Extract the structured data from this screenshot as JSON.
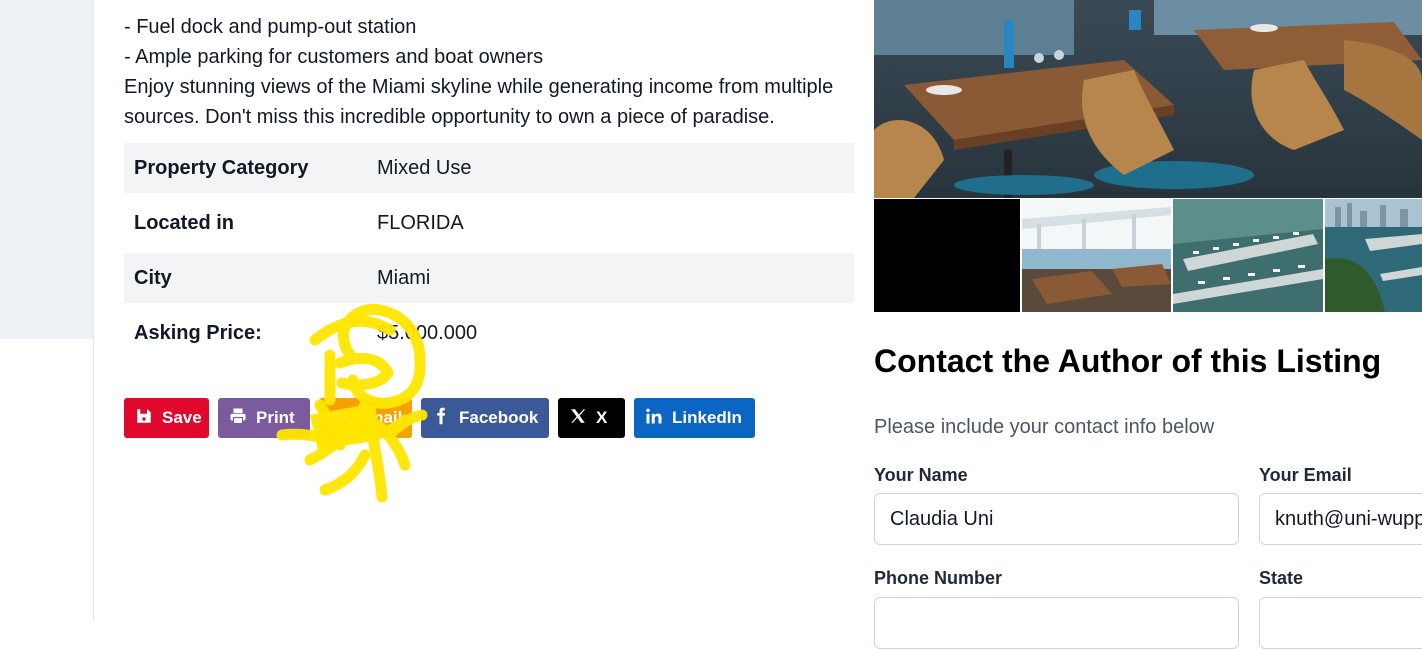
{
  "description": {
    "lines": [
      "- Fuel dock and pump-out station",
      "- Ample parking for customers and boat owners",
      "Enjoy stunning views of the Miami skyline while generating income from multiple",
      "sources. Don't miss this incredible opportunity to own a piece of paradise."
    ]
  },
  "properties": [
    {
      "key": "Property Category",
      "value": "Mixed Use"
    },
    {
      "key": "Located in",
      "value": "FLORIDA"
    },
    {
      "key": "City",
      "value": "Miami"
    },
    {
      "key": "Asking Price:",
      "value": "$5.000.000"
    }
  ],
  "share": {
    "save": "Save",
    "print": "Print",
    "email": "Email",
    "facebook": "Facebook",
    "x": "X",
    "linkedin": "LinkedIn"
  },
  "gallery": {
    "icons": [
      "restaurant-photo",
      "restaurant-thumb",
      "marina-aerial-thumb",
      "marina-skyline-thumb"
    ]
  },
  "contact": {
    "title": "Contact the Author of this Listing",
    "subtitle": "Please include your contact info below",
    "name_label": "Your Name",
    "name_value": "Claudia Uni",
    "email_label": "Your Email",
    "email_value": "knuth@uni-wupp",
    "phone_label": "Phone Number",
    "state_label": "State"
  },
  "colors": {
    "save": "#e0082d",
    "print": "#7b5b9e",
    "email": "#f5a200",
    "facebook": "#3b5998",
    "x": "#000000",
    "linkedin": "#0a66c2",
    "annotation": "#ffe600"
  }
}
